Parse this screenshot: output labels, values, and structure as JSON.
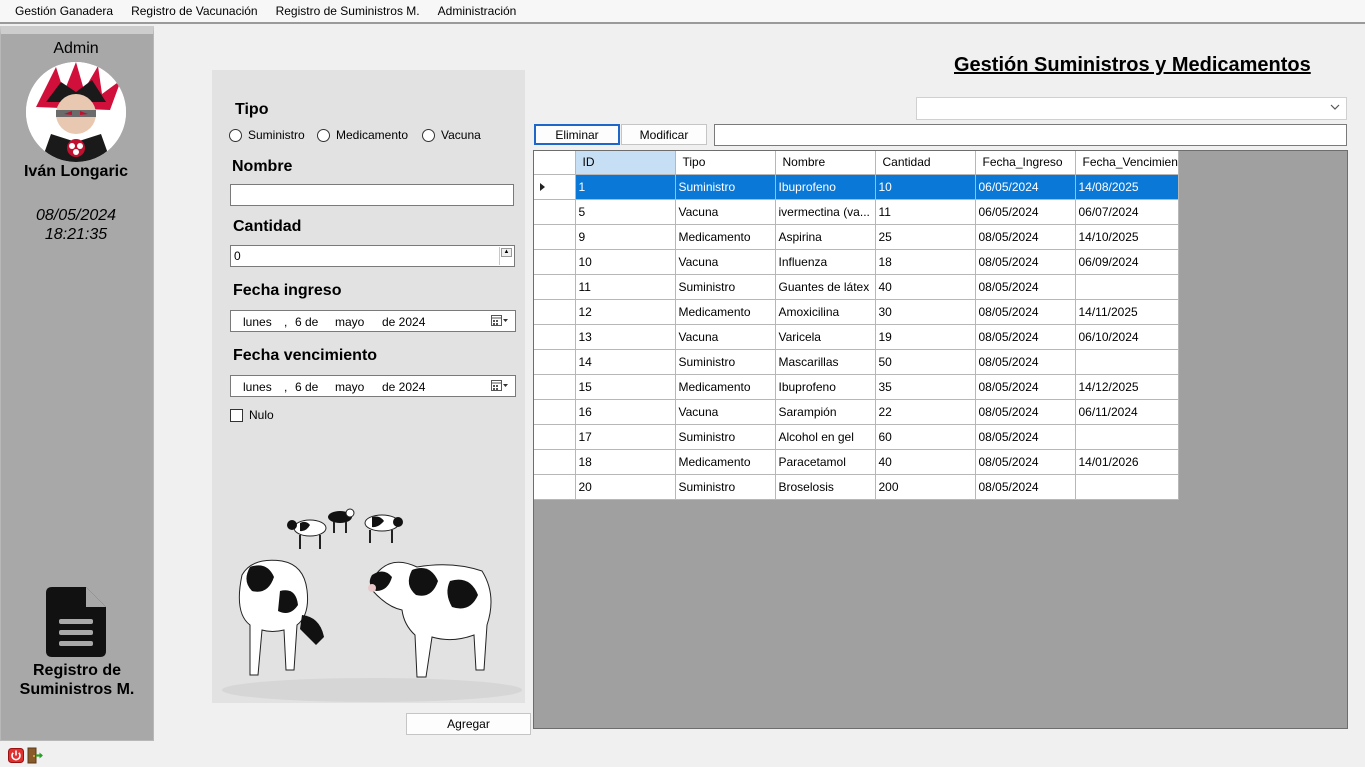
{
  "menu": {
    "items": [
      "Gestión Ganadera",
      "Registro de Vacunación",
      "Registro de Suministros M.",
      "Administración"
    ]
  },
  "sidebar": {
    "role": "Admin",
    "username": "Iván Longaric",
    "date": "08/05/2024",
    "time": "18:21:35",
    "section_line1": "Registro de",
    "section_line2": "Suministros M."
  },
  "form": {
    "tipo_label": "Tipo",
    "radio_options": [
      "Suministro",
      "Medicamento",
      "Vacuna"
    ],
    "nombre_label": "Nombre",
    "nombre_value": "",
    "cantidad_label": "Cantidad",
    "cantidad_value": "0",
    "fecha_ingreso_label": "Fecha ingreso",
    "fecha_ingreso": {
      "weekday": "lunes",
      "comma": ",",
      "day": "6 de",
      "month": "mayo",
      "year": "de 2024"
    },
    "fecha_vencimiento_label": "Fecha vencimiento",
    "fecha_vencimiento": {
      "weekday": "lunes",
      "comma": ",",
      "day": "6 de",
      "month": "mayo",
      "year": "de 2024"
    },
    "nulo_label": "Nulo",
    "agregar_label": "Agregar"
  },
  "main": {
    "title": "Gestión Suministros y Medicamentos",
    "filter_value": "",
    "eliminar_label": "Eliminar",
    "modificar_label": "Modificar",
    "search_value": ""
  },
  "grid": {
    "columns": [
      "ID",
      "Tipo",
      "Nombre",
      "Cantidad",
      "Fecha_Ingreso",
      "Fecha_Vencimien"
    ],
    "rows": [
      [
        "1",
        "Suministro",
        "Ibuprofeno",
        "10",
        "06/05/2024",
        "14/08/2025"
      ],
      [
        "5",
        "Vacuna",
        "ivermectina (va...",
        "11",
        "06/05/2024",
        "06/07/2024"
      ],
      [
        "9",
        "Medicamento",
        "Aspirina",
        "25",
        "08/05/2024",
        "14/10/2025"
      ],
      [
        "10",
        "Vacuna",
        "Influenza",
        "18",
        "08/05/2024",
        "06/09/2024"
      ],
      [
        "11",
        "Suministro",
        "Guantes de látex",
        "40",
        "08/05/2024",
        ""
      ],
      [
        "12",
        "Medicamento",
        "Amoxicilina",
        "30",
        "08/05/2024",
        "14/11/2025"
      ],
      [
        "13",
        "Vacuna",
        "Varicela",
        "19",
        "08/05/2024",
        "06/10/2024"
      ],
      [
        "14",
        "Suministro",
        "Mascarillas",
        "50",
        "08/05/2024",
        ""
      ],
      [
        "15",
        "Medicamento",
        "Ibuprofeno",
        "35",
        "08/05/2024",
        "14/12/2025"
      ],
      [
        "16",
        "Vacuna",
        "Sarampión",
        "22",
        "08/05/2024",
        "06/11/2024"
      ],
      [
        "17",
        "Suministro",
        "Alcohol en gel",
        "60",
        "08/05/2024",
        ""
      ],
      [
        "18",
        "Medicamento",
        "Paracetamol",
        "40",
        "08/05/2024",
        "14/01/2026"
      ],
      [
        "20",
        "Suministro",
        "Broselosis",
        "200",
        "08/05/2024",
        ""
      ]
    ],
    "selected_row": 0
  },
  "colors": {
    "selection": "#0a78d7",
    "header_selected": "#c7dff4",
    "sidebar": "#a8a8a8",
    "grid_background": "#a0a0a0"
  },
  "icons": [
    "avatar-image",
    "document-icon",
    "calendar-icon",
    "chevron-down-icon",
    "power-icon",
    "exit-door-icon"
  ]
}
